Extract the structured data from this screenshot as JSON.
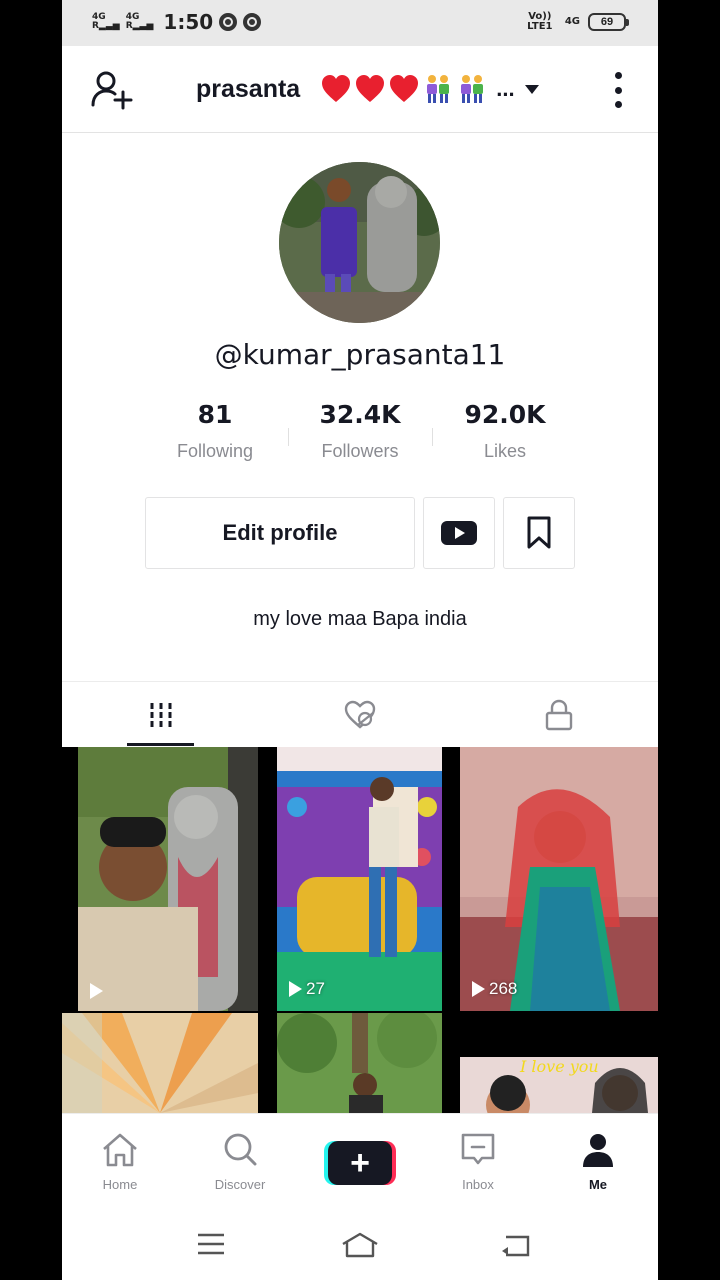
{
  "status_bar": {
    "sim1": "4G",
    "sim2": "4G",
    "time": "1:50",
    "volte": "Vo)) LTE1",
    "net2": "4G",
    "battery": "69"
  },
  "header": {
    "title": "prasanta",
    "ellipsis": "..."
  },
  "profile": {
    "handle": "@kumar_prasanta11",
    "stats": [
      {
        "value": "81",
        "label": "Following"
      },
      {
        "value": "32.4K",
        "label": "Followers"
      },
      {
        "value": "92.0K",
        "label": "Likes"
      }
    ],
    "edit_label": "Edit profile",
    "bio": "my love maa Bapa  india"
  },
  "tabs": [
    {
      "icon": "grid-icon",
      "active": true
    },
    {
      "icon": "hidden-likes-icon",
      "active": false
    },
    {
      "icon": "lock-icon",
      "active": false
    }
  ],
  "videos": [
    {
      "count": ""
    },
    {
      "count": "27"
    },
    {
      "count": "268"
    },
    {
      "count": ""
    },
    {
      "count": ""
    },
    {
      "overlay_text": "I love you"
    }
  ],
  "bottom_nav": [
    {
      "label": "Home",
      "icon": "home-icon"
    },
    {
      "label": "Discover",
      "icon": "search-icon"
    },
    {
      "label": "",
      "icon": "create-plus-icon"
    },
    {
      "label": "Inbox",
      "icon": "inbox-icon"
    },
    {
      "label": "Me",
      "icon": "profile-icon",
      "active": true
    }
  ],
  "colors": {
    "text": "#161823",
    "secondary_text": "#8a8b91",
    "create_cyan": "#25f4ee",
    "create_red": "#fe2c55",
    "heart": "#e8202f"
  }
}
